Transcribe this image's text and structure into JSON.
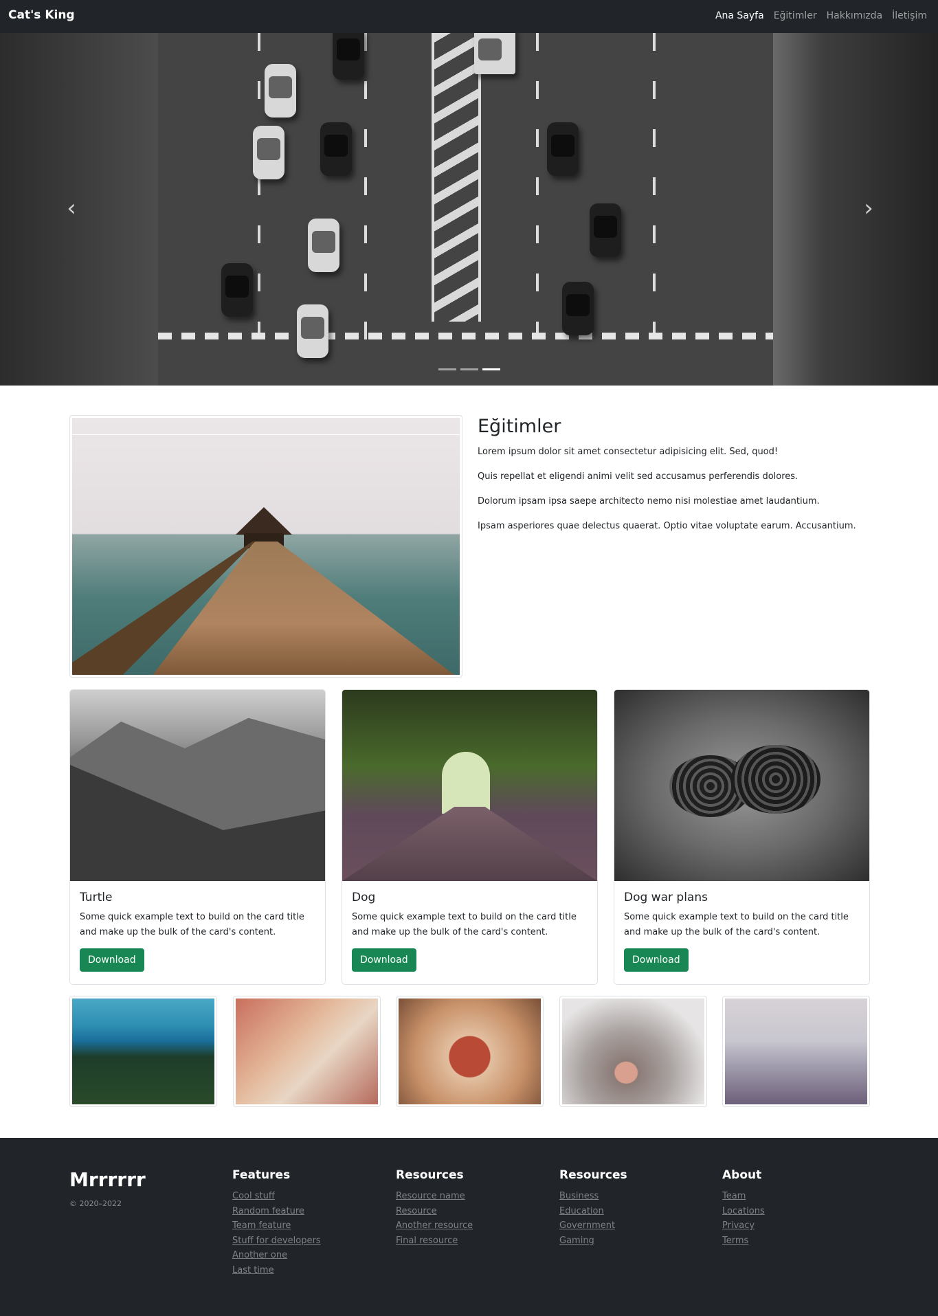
{
  "navbar": {
    "brand": "Cat's King",
    "links": [
      "Ana Sayfa",
      "Eğitimler",
      "Hakkımızda",
      "İletişim"
    ]
  },
  "carousel": {
    "prev_icon": "‹",
    "next_icon": "›",
    "slides": 3,
    "active_slide": 3
  },
  "feature": {
    "title": "Eğitimler",
    "paragraphs": [
      "Lorem ipsum dolor sit amet consectetur adipisicing elit. Sed, quod!",
      "Quis repellat et eligendi animi velit sed accusamus perferendis dolores.",
      "Dolorum ipsam ipsa saepe architecto nemo nisi molestiae amet laudantium.",
      "Ipsam asperiores quae delectus quaerat. Optio vitae voluptate earum. Accusantium."
    ]
  },
  "cards": [
    {
      "title": "Turtle",
      "text": "Some quick example text to build on the card title and make up the bulk of the card's content.",
      "button": "Download"
    },
    {
      "title": "Dog",
      "text": "Some quick example text to build on the card title and make up the bulk of the card's content.",
      "button": "Download"
    },
    {
      "title": "Dog war plans",
      "text": "Some quick example text to build on the card title and make up the bulk of the card's content.",
      "button": "Download"
    }
  ],
  "footer": {
    "brand": "Mrrrrrr",
    "copyright": "© 2020–2022",
    "columns": [
      {
        "heading": "Features",
        "links": [
          "Cool stuff",
          "Random feature",
          "Team feature",
          "Stuff for developers",
          "Another one",
          "Last time"
        ]
      },
      {
        "heading": "Resources",
        "links": [
          "Resource name",
          "Resource",
          "Another resource",
          "Final resource"
        ]
      },
      {
        "heading": "Resources",
        "links": [
          "Business",
          "Education",
          "Government",
          "Gaming"
        ]
      },
      {
        "heading": "About",
        "links": [
          "Team",
          "Locations",
          "Privacy",
          "Terms"
        ]
      }
    ]
  },
  "colors": {
    "navbar_bg": "#212529",
    "button_green": "#198754",
    "footer_bg": "#212529"
  }
}
